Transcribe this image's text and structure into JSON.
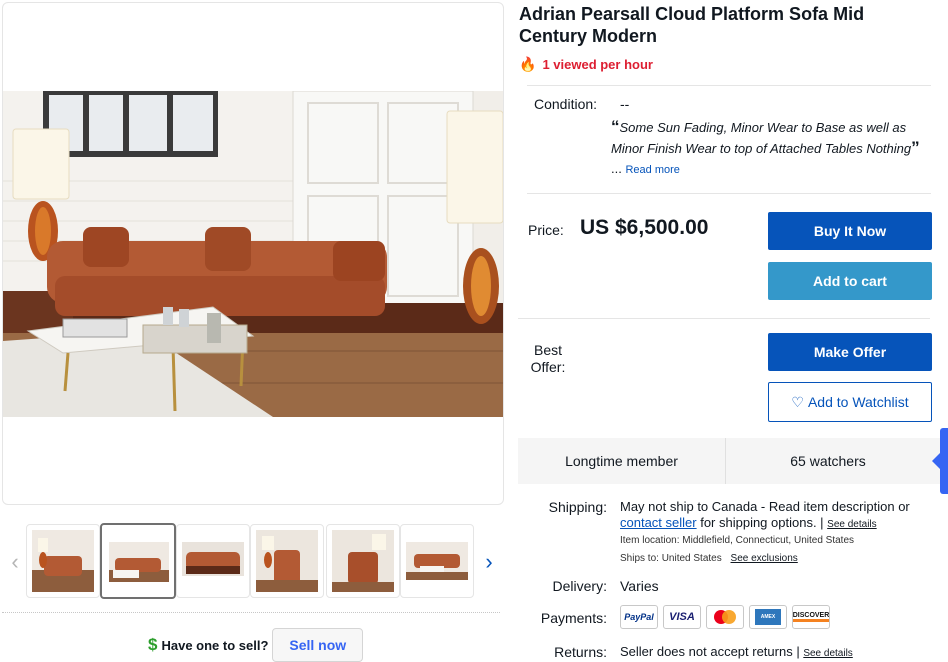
{
  "listing": {
    "title": "Adrian Pearsall Cloud Platform Sofa Mid Century Modern",
    "viewed": "1 viewed per hour"
  },
  "condition": {
    "label": "Condition:",
    "value": "--",
    "quote": "Some Sun Fading, Minor Wear to Base as well as Minor Finish Wear to top of Attached Tables Nothing",
    "ellipsis": "...",
    "read_more": "Read more"
  },
  "price": {
    "label": "Price:",
    "value": "US $6,500.00"
  },
  "buttons": {
    "buy_now": "Buy It Now",
    "add_to_cart": "Add to cart",
    "make_offer": "Make Offer",
    "watchlist": "Add to Watchlist"
  },
  "offer": {
    "label_line1": "Best",
    "label_line2": "Offer:"
  },
  "stats": {
    "member": "Longtime member",
    "watchers": "65 watchers"
  },
  "shipping": {
    "label": "Shipping:",
    "text_before": "May not ship to Canada - Read item description or ",
    "contact_link": "contact seller",
    "text_after": " for shipping options. | ",
    "see_details": "See details",
    "location_label": "Item location:",
    "location_value": "Middlefield, Connecticut, United States",
    "ships_to_label": "Ships to:",
    "ships_to_value": "United States",
    "see_exclusions": "See exclusions"
  },
  "delivery": {
    "label": "Delivery:",
    "value": "Varies"
  },
  "payments": {
    "label": "Payments:",
    "methods": [
      "PayPal",
      "VISA",
      "Mastercard",
      "American Express",
      "DISCOVER"
    ]
  },
  "returns": {
    "label": "Returns:",
    "value": "Seller does not accept returns | ",
    "see_details": "See details"
  },
  "sell": {
    "dollar": "$",
    "prompt": "Have one to sell?",
    "button": "Sell now"
  },
  "gallery": {
    "thumbnail_count": 6,
    "active_index": 1
  },
  "colors": {
    "primary_blue": "#0654ba",
    "cart_blue": "#3498ca",
    "alert_red": "#dd1e31",
    "sofa_rust": "#b35a34"
  }
}
